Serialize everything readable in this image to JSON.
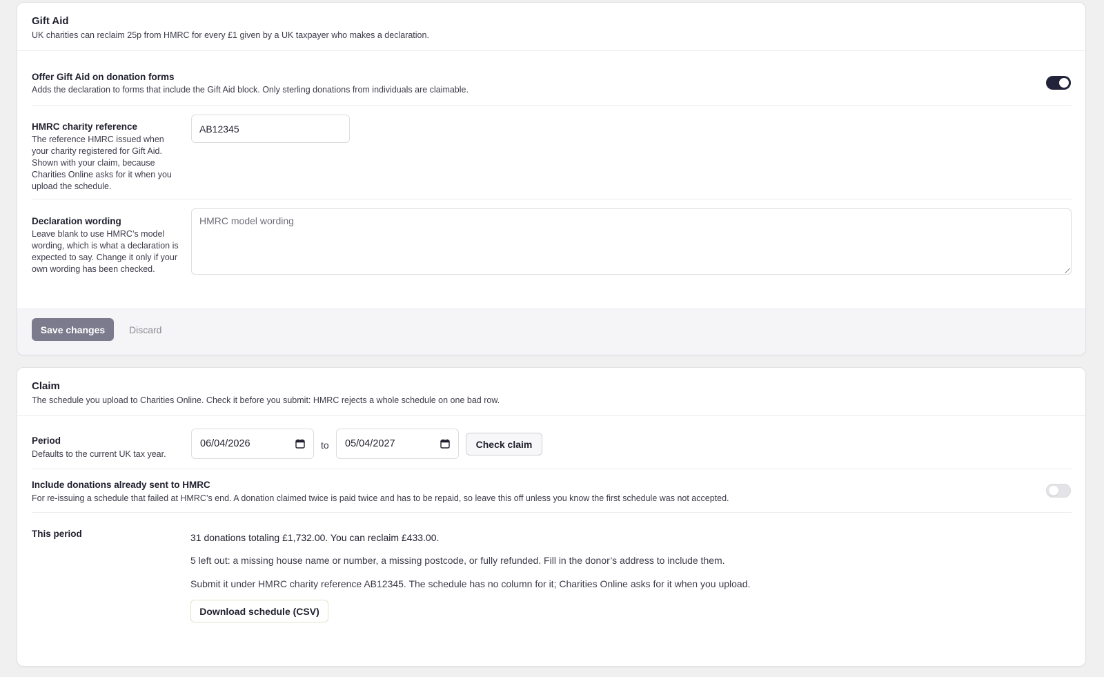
{
  "gift_aid": {
    "title": "Gift Aid",
    "description": "UK charities can reclaim 25p from HMRC for every £1 given by a UK taxpayer who makes a declaration.",
    "offer": {
      "label": "Offer Gift Aid on donation forms",
      "help": "Adds the declaration to forms that include the Gift Aid block. Only sterling donations from individuals are claimable.",
      "enabled": true
    },
    "reference": {
      "label": "HMRC charity reference",
      "help": "The reference HMRC issued when your charity registered for Gift Aid. Shown with your claim, because Charities Online asks for it when you upload the schedule.",
      "value": "AB12345"
    },
    "declaration": {
      "label": "Declaration wording",
      "help": "Leave blank to use HMRC’s model wording, which is what a declaration is expected to say. Change it only if your own wording has been checked.",
      "placeholder": "HMRC model wording",
      "value": ""
    },
    "footer": {
      "save_label": "Save changes",
      "discard_label": "Discard"
    }
  },
  "claim": {
    "title": "Claim",
    "description": "The schedule you upload to Charities Online. Check it before you submit: HMRC rejects a whole schedule on one bad row.",
    "period": {
      "label": "Period",
      "help": "Defaults to the current UK tax year.",
      "from": "06/04/2026",
      "separator": "to",
      "to": "05/04/2027",
      "check_label": "Check claim"
    },
    "include_sent": {
      "label": "Include donations already sent to HMRC",
      "help": "For re-issuing a schedule that failed at HMRC’s end. A donation claimed twice is paid twice and has to be repaid, so leave this off unless you know the first schedule was not accepted.",
      "enabled": false
    },
    "this_period": {
      "label": "This period",
      "summary": "31 donations totaling £1,732.00. You can reclaim £433.00.",
      "left_out": "5 left out: a missing house name or number, a missing postcode, or fully refunded. Fill in the donor’s address to include them.",
      "submit_note": "Submit it under HMRC charity reference AB12345. The schedule has no column for it; Charities Online asks for it when you upload.",
      "download_label": "Download schedule (CSV)"
    }
  },
  "colors": {
    "page_bg": "#f0f0f0",
    "toggle_on": "#22223a",
    "save_button": "#7c7b8e"
  }
}
